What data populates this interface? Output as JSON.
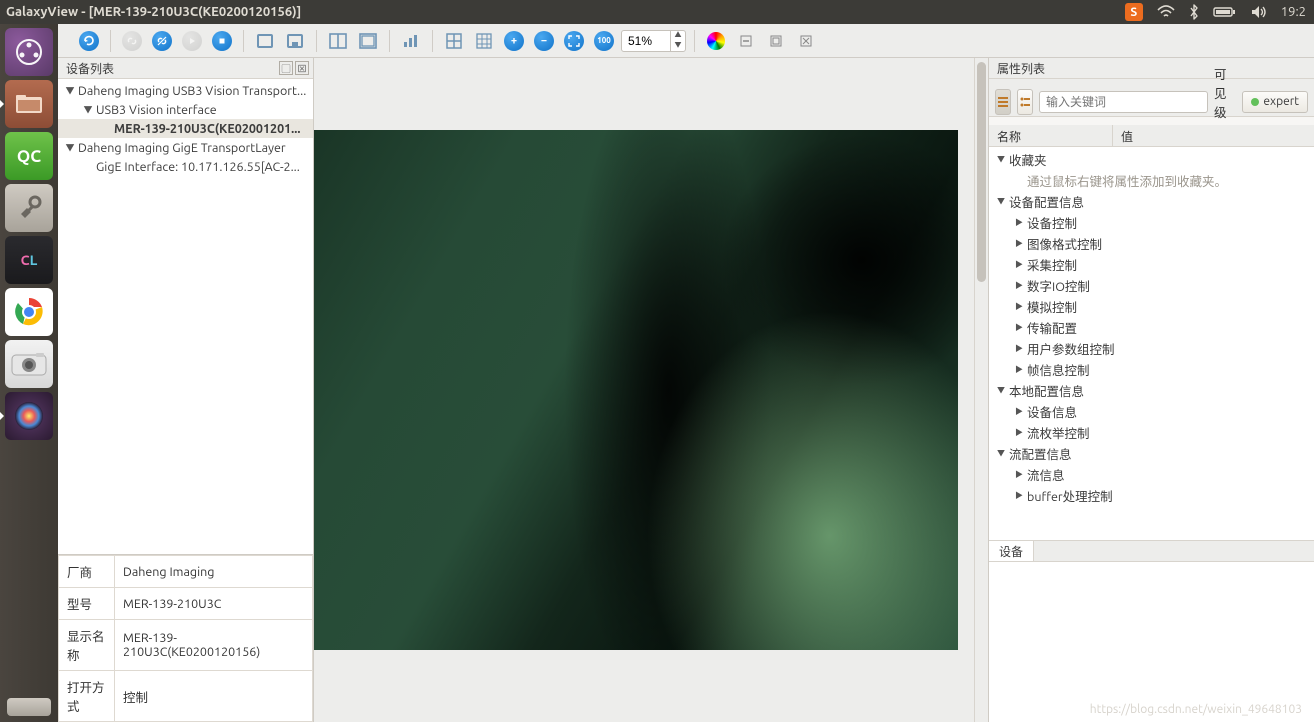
{
  "window": {
    "title": "GalaxyView - [MER-139-210U3C(KE0200120156)]"
  },
  "menubar": {
    "time": "19:2",
    "input_method_badge": "S"
  },
  "launcher": {
    "items": [
      {
        "name": "dash-home",
        "tooltip": "Dash"
      },
      {
        "name": "files",
        "tooltip": "文件"
      },
      {
        "name": "qc",
        "label": "QC"
      },
      {
        "name": "settings",
        "tooltip": "设置"
      },
      {
        "name": "clion",
        "label": "CL"
      },
      {
        "name": "chrome",
        "tooltip": "Google Chrome"
      },
      {
        "name": "camera",
        "tooltip": "相机"
      },
      {
        "name": "galaxy-swirl",
        "tooltip": "GalaxyView"
      }
    ]
  },
  "toolbar": {
    "zoom_value": "51%",
    "zoom_100_label": "100"
  },
  "device_list": {
    "title": "设备列表",
    "nodes": [
      {
        "level": 0,
        "expanded": true,
        "label": "Daheng Imaging USB3 Vision Transport..."
      },
      {
        "level": 1,
        "expanded": true,
        "label": "USB3 Vision interface"
      },
      {
        "level": 2,
        "expanded": false,
        "label": "MER-139-210U3C(KE02001201...",
        "selected": true
      },
      {
        "level": 0,
        "expanded": true,
        "label": "Daheng Imaging GigE TransportLayer"
      },
      {
        "level": 1,
        "expanded": false,
        "label": "GigE Interface: 10.171.126.55[AC-2..."
      }
    ]
  },
  "device_info": {
    "rows": [
      {
        "k": "厂商",
        "v": "Daheng Imaging"
      },
      {
        "k": "型号",
        "v": "MER-139-210U3C"
      },
      {
        "k": "显示名称",
        "v": "MER-139-210U3C(KE0200120156)"
      },
      {
        "k": "打开方式",
        "v": "控制"
      }
    ]
  },
  "properties": {
    "title": "属性列表",
    "search_placeholder": "输入关键词",
    "visibility_label": "可见级别",
    "expert_label": "expert",
    "header_name": "名称",
    "header_value": "值",
    "nodes": [
      {
        "level": 0,
        "arrow": "down",
        "label": "收藏夹"
      },
      {
        "level": 1,
        "arrow": "",
        "label": "通过鼠标右键将属性添加到收藏夹。",
        "muted": true
      },
      {
        "level": 0,
        "arrow": "down",
        "label": "设备配置信息"
      },
      {
        "level": 1,
        "arrow": "right",
        "label": "设备控制"
      },
      {
        "level": 1,
        "arrow": "right",
        "label": "图像格式控制"
      },
      {
        "level": 1,
        "arrow": "right",
        "label": "采集控制"
      },
      {
        "level": 1,
        "arrow": "right",
        "label": "数字IO控制"
      },
      {
        "level": 1,
        "arrow": "right",
        "label": "模拟控制"
      },
      {
        "level": 1,
        "arrow": "right",
        "label": "传输配置"
      },
      {
        "level": 1,
        "arrow": "right",
        "label": "用户参数组控制"
      },
      {
        "level": 1,
        "arrow": "right",
        "label": "帧信息控制"
      },
      {
        "level": 0,
        "arrow": "down",
        "label": "本地配置信息"
      },
      {
        "level": 1,
        "arrow": "right",
        "label": "设备信息"
      },
      {
        "level": 1,
        "arrow": "right",
        "label": "流枚举控制"
      },
      {
        "level": 0,
        "arrow": "down",
        "label": "流配置信息"
      },
      {
        "level": 1,
        "arrow": "right",
        "label": "流信息"
      },
      {
        "level": 1,
        "arrow": "right",
        "label": "buffer处理控制"
      }
    ],
    "tab_label": "设备"
  },
  "watermark": "https://blog.csdn.net/weixin_49648103"
}
